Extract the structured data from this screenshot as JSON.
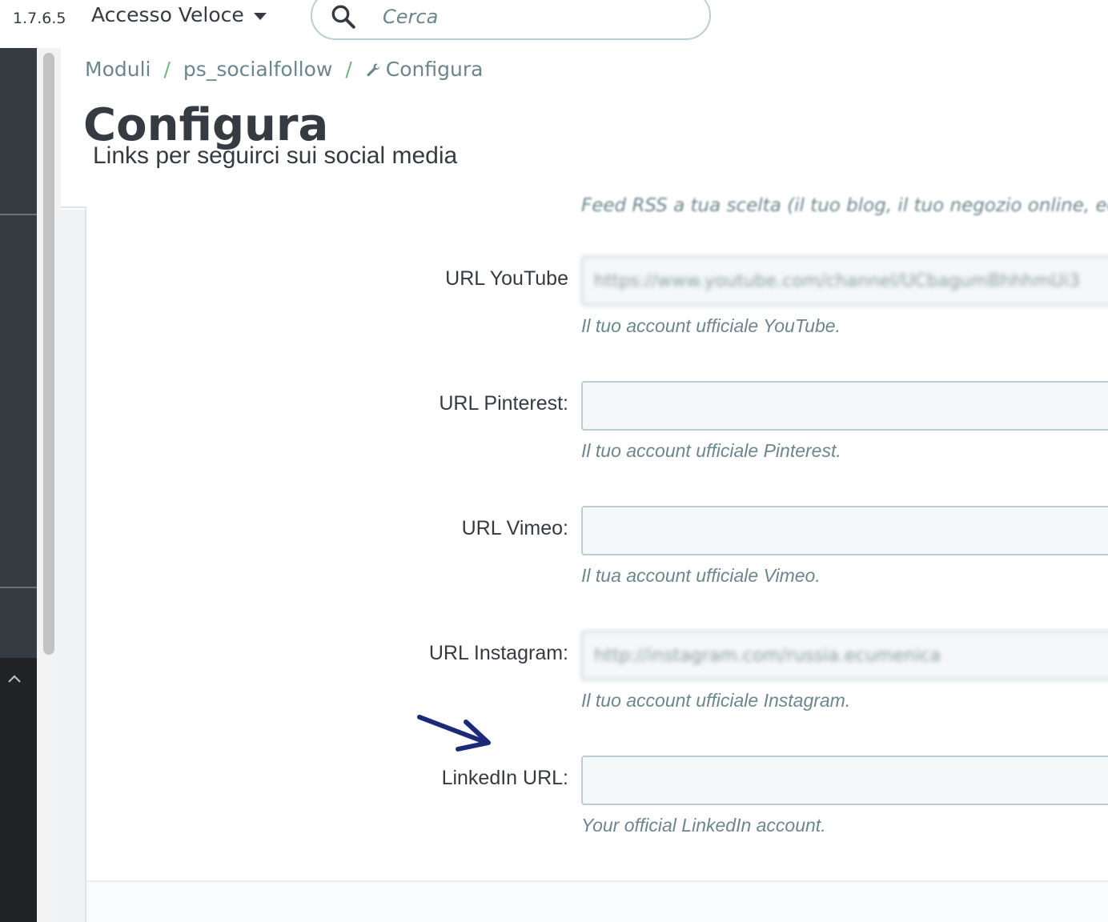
{
  "topbar": {
    "version": "1.7.6.5",
    "quick_access_label": "Accesso Veloce",
    "search_placeholder": "Cerca"
  },
  "breadcrumb": {
    "items": [
      "Moduli",
      "ps_socialfollow",
      "Configura"
    ],
    "separator": "/"
  },
  "page": {
    "title": "Configura",
    "subtitle": "Links per seguirci sui social media"
  },
  "form": {
    "truncated_help_above": "Feed RSS a tua scelta (il tuo blog, il tuo negozio online, ecc.).",
    "fields": [
      {
        "label": "URL YouTube",
        "value": "https://www.youtube.com/channel/UCbagumBhhhmUi3",
        "help": "Il tuo account ufficiale YouTube."
      },
      {
        "label": "URL Pinterest:",
        "value": "",
        "help": "Il tuo account ufficiale Pinterest."
      },
      {
        "label": "URL Vimeo:",
        "value": "",
        "help": "Il tua account ufficiale Vimeo."
      },
      {
        "label": "URL Instagram:",
        "value": "http://instagram.com/russia.ecumenica",
        "help": "Il tuo account ufficiale Instagram."
      },
      {
        "label": "LinkedIn URL:",
        "value": "",
        "help": "Your official LinkedIn account."
      }
    ]
  },
  "colors": {
    "sidebar": "#363a41",
    "sidebar_dark": "#202226",
    "breadcrumb_separator": "#70b580",
    "input_border": "#bbcdd2",
    "annotation_arrow": "#1c2a7a"
  },
  "icons": [
    "search-icon",
    "chevron-down-icon",
    "wrench-icon",
    "chevron-up-icon",
    "arrow-annotation-icon"
  ]
}
